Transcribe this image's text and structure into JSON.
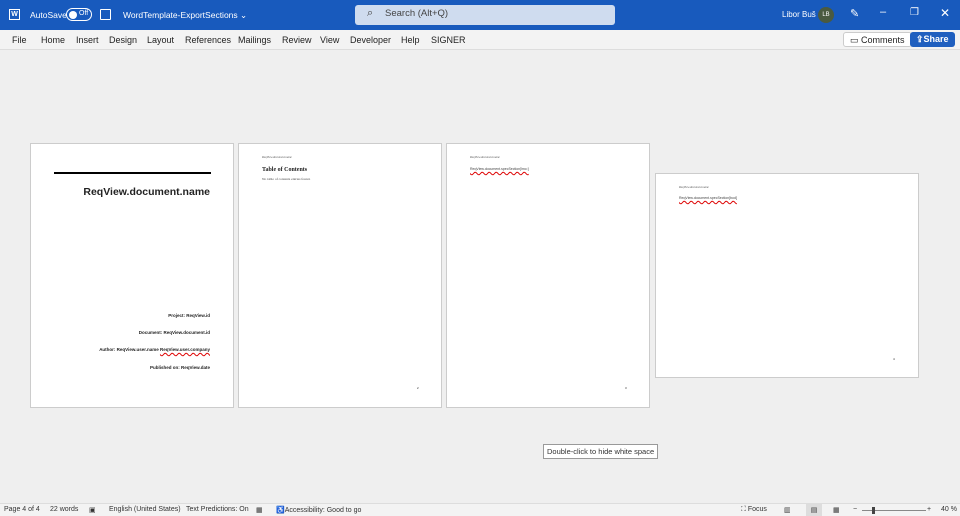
{
  "titlebar": {
    "autosave_label": "AutoSave",
    "autosave_state": "Off",
    "doc_title": "WordTemplate-ExportSections",
    "search_placeholder": "Search (Alt+Q)",
    "user_name": "Libor Buš",
    "user_initials": "LB"
  },
  "menu": {
    "items": [
      "File",
      "Home",
      "Insert",
      "Design",
      "Layout",
      "References",
      "Mailings",
      "Review",
      "View",
      "Developer",
      "Help",
      "SIGNER"
    ],
    "comments": "Comments",
    "share": "Share"
  },
  "pages": {
    "p1": {
      "title": "ReqView.document.name",
      "project": "Project: ReqView.id",
      "document": "Document: ReqView.document.id",
      "author": "Author: ReqView.user.name",
      "company": "ReqView.user.company",
      "published": "Published on: ReqView.date"
    },
    "p2": {
      "header": "ReqView.document.name",
      "toc_title": "Table of Contents",
      "toc_empty": "No table of contents entries found.",
      "number": "2"
    },
    "p3": {
      "header": "ReqView.document.name",
      "field": "ReqView.document.specSection[lmo:]",
      "number": "3"
    },
    "p4": {
      "header": "ReqView.document.name",
      "field": "ReqView.document.specSection[bod]",
      "number": "4"
    }
  },
  "tooltip": "Double-click to hide white space",
  "status": {
    "page": "Page 4 of 4",
    "words": "22 words",
    "language": "English (United States)",
    "predictions": "Text Predictions: On",
    "accessibility": "Accessibility: Good to go",
    "focus": "Focus",
    "zoom": "40 %",
    "zoom_value": 40
  }
}
